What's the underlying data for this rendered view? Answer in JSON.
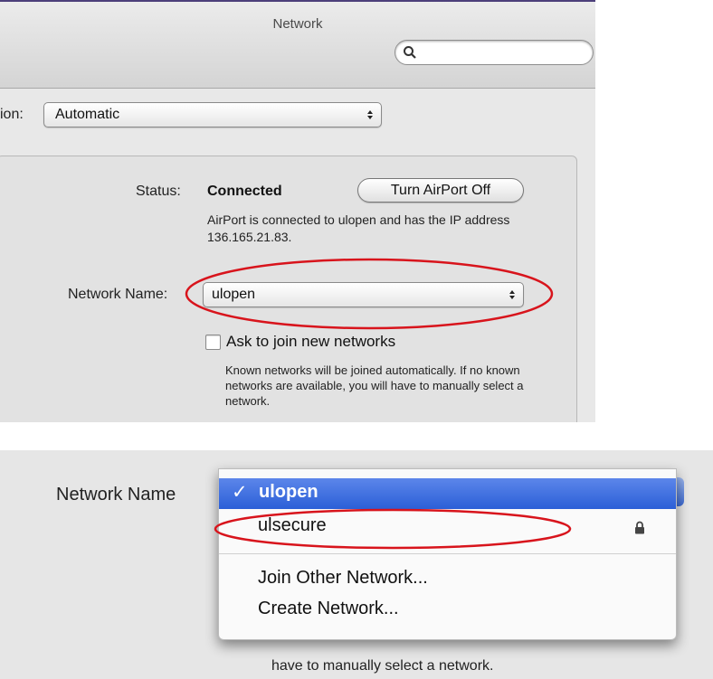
{
  "window": {
    "title": "Network"
  },
  "search": {
    "placeholder": ""
  },
  "location": {
    "label": "ion:",
    "value": "Automatic"
  },
  "status": {
    "label": "Status:",
    "value": "Connected",
    "button_label": "Turn AirPort Off",
    "description": "AirPort is connected to ulopen and has the IP address 136.165.21.83."
  },
  "network_name": {
    "label": "Network Name:",
    "value": "ulopen"
  },
  "ask_join": {
    "checked": false,
    "label": "Ask to join new networks",
    "description": "Known networks will be joined automatically. If no known networks are available, you will have to manually select a network."
  },
  "dropdown": {
    "label": "Network Name",
    "items": [
      {
        "label": "ulopen",
        "selected": true,
        "secure": false
      },
      {
        "label": "ulsecure",
        "selected": false,
        "secure": true
      }
    ],
    "actions": [
      "Join Other Network...",
      "Create Network..."
    ],
    "behind_text": "have to manually select a network."
  },
  "colors": {
    "highlight_oval": "#d8141c",
    "menu_selection": "#3a6bdc"
  },
  "icons": {
    "search": "search-icon",
    "lock": "lock-icon",
    "check": "checkmark-icon",
    "updown": "updown-arrows-icon"
  }
}
